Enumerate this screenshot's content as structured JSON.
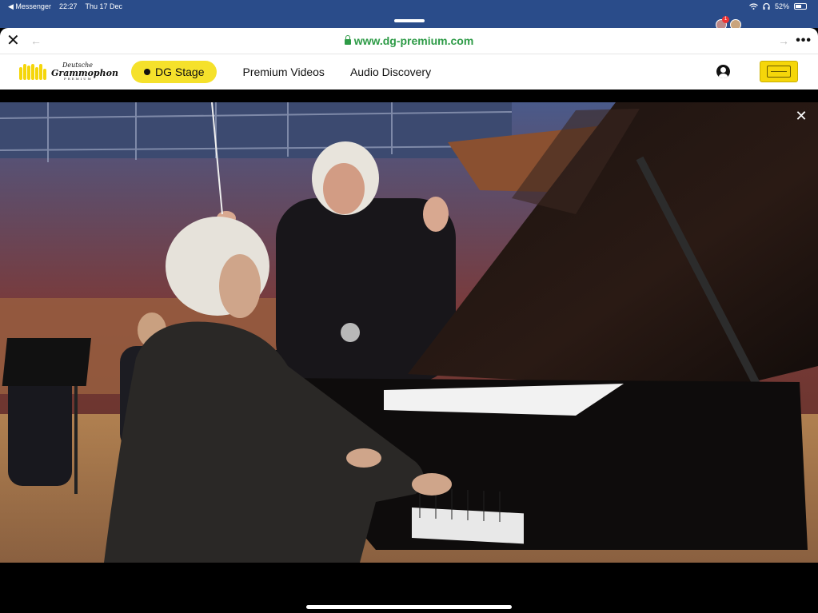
{
  "status_bar": {
    "back_app": "◀ Messenger",
    "time": "22:27",
    "date": "Thu 17 Dec",
    "battery": "52%",
    "battery_level": 0.52,
    "notification_count": "1"
  },
  "browser": {
    "close_glyph": "✕",
    "back_glyph": "←",
    "forward_glyph": "→",
    "more_glyph": "•••",
    "url": "www.dg-premium.com"
  },
  "site": {
    "logo": {
      "line1": "Deutsche",
      "line2": "Grammophon",
      "line3": "PREMIUM"
    },
    "nav": [
      {
        "label": "DG Stage",
        "active": true
      },
      {
        "label": "Premium Videos",
        "active": false
      },
      {
        "label": "Audio Discovery",
        "active": false
      }
    ],
    "accent_color": "#f5e12b"
  },
  "video": {
    "close_glyph": "✕",
    "scene": "Pianist at grand piano with conductor and orchestra on concert stage"
  },
  "icons": [
    "lock-icon",
    "account-icon",
    "close-icon",
    "back-arrow-icon",
    "forward-arrow-icon",
    "more-icon",
    "wifi-icon",
    "headphones-icon",
    "battery-icon"
  ]
}
